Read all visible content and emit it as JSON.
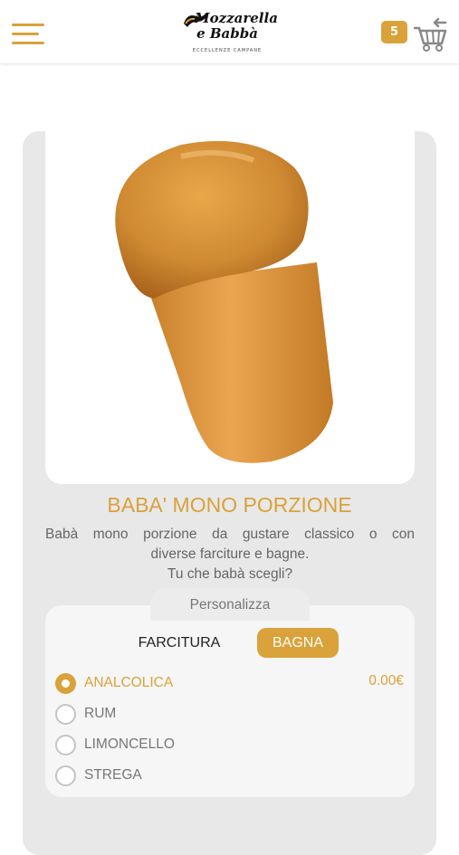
{
  "header": {
    "logo_text": "Mozzarella e Babbà",
    "logo_tagline": "ECCELLENZE CAMPANE",
    "cart_count": "5"
  },
  "product": {
    "title": "BABA' MONO PORZIONE",
    "description_line1": "Babà mono porzione da gustare classico o con",
    "description_line2": "diverse farciture e bagne.",
    "description_line3": "Tu che babà scegli?"
  },
  "customize": {
    "label": "Personalizza",
    "tabs": [
      {
        "label": "FARCITURA",
        "active": false
      },
      {
        "label": "BAGNA",
        "active": true
      }
    ],
    "options": [
      {
        "label": "ANALCOLICA",
        "price": "0.00€",
        "selected": true
      },
      {
        "label": "RUM",
        "selected": false
      },
      {
        "label": "LIMONCELLO",
        "selected": false
      },
      {
        "label": "STREGA",
        "selected": false
      }
    ]
  },
  "colors": {
    "accent": "#d9a23a",
    "card_bg": "#e8e8e8",
    "text_muted": "#777777"
  }
}
